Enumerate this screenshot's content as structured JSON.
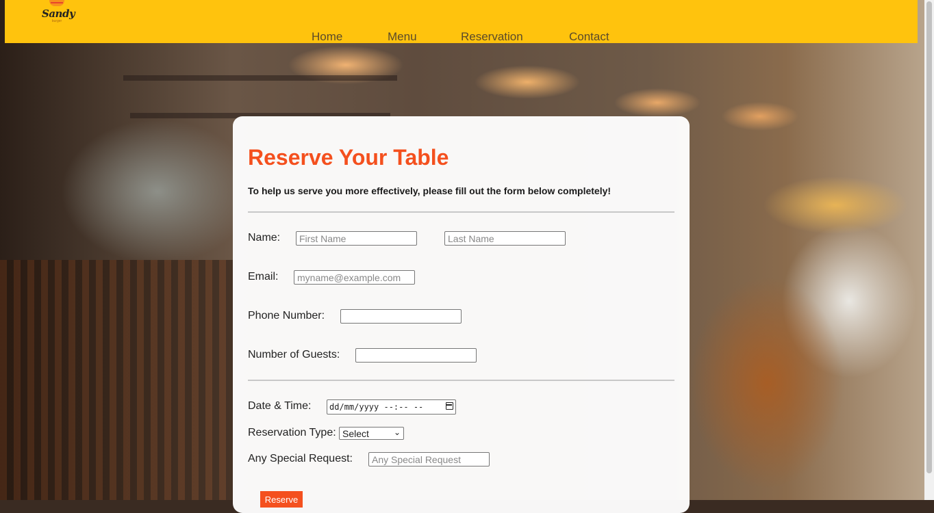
{
  "brand": {
    "logo_text": "Sandy",
    "logo_sub": "burger"
  },
  "nav": {
    "home": "Home",
    "menu": "Menu",
    "reservation": "Reservation",
    "contact": "Contact"
  },
  "form": {
    "title": "Reserve Your Table",
    "intro": "To help us serve you more effectively, please fill out the form below completely!",
    "name_label": "Name:",
    "first_name_placeholder": "First Name",
    "last_name_placeholder": "Last Name",
    "email_label": "Email:",
    "email_placeholder": "myname@example.com",
    "phone_label": "Phone Number:",
    "guests_label": "Number of Guests:",
    "datetime_label": "Date & Time:",
    "datetime_value": "dd/mm/yyyy --:-- --",
    "reservation_type_label": "Reservation Type:",
    "reservation_type_value": "Select",
    "special_request_label": "Any Special Request:",
    "special_request_placeholder": "Any Special Request",
    "submit_label": "Reserve"
  },
  "colors": {
    "header": "#ffc30d",
    "accent": "#f4501e"
  }
}
